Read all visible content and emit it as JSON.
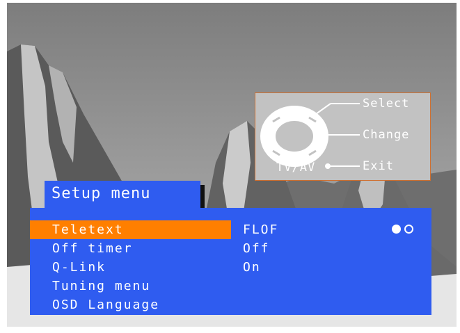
{
  "title": "Setup menu",
  "menu": {
    "items": [
      {
        "label": "Teletext",
        "value": "FLOF",
        "selected": true
      },
      {
        "label": "Off timer",
        "value": "Off"
      },
      {
        "label": "Q-Link",
        "value": "On"
      },
      {
        "label": "Tuning menu",
        "value": ""
      },
      {
        "label": "OSD Language",
        "value": ""
      }
    ]
  },
  "help": {
    "select_label": "Select",
    "change_label": "Change",
    "exit_label": "Exit",
    "tvav_label": "TV/AV"
  },
  "colors": {
    "menu_bg": "#2f5cf0",
    "highlight": "#ff7f00",
    "help_bg": "#c2c2c2"
  },
  "icons": [
    "arrow-up-icon",
    "arrow-down-icon",
    "minus-icon",
    "plus-icon",
    "filled-dot-icon",
    "hollow-dot-icon"
  ]
}
